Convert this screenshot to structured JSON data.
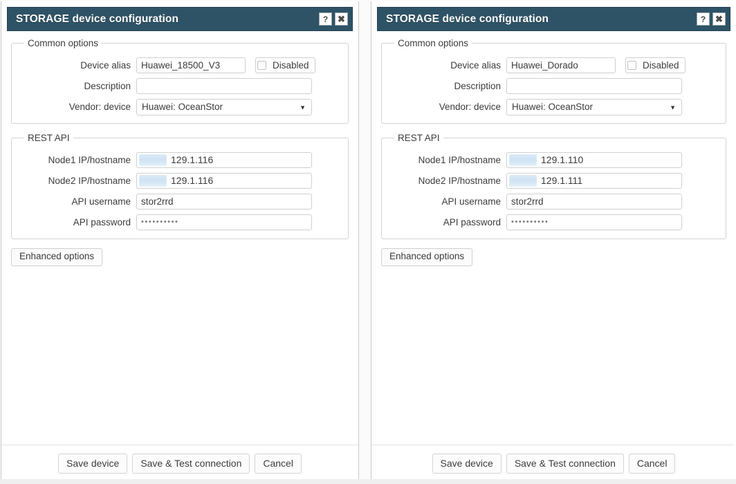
{
  "theme": {
    "titlebar_bg": "#2e5366",
    "titlebar_text": "#ffffff",
    "dialog_bg": "#ffffff",
    "border": "#cfcfcf",
    "label_text": "#3b3b3b",
    "redaction": "#cfe3f4"
  },
  "icons": {
    "help": "?",
    "close": "✖",
    "dropdown_caret": "▼",
    "checkbox_unchecked": "checkbox-unchecked-icon"
  },
  "panels": [
    {
      "id": "left",
      "titlebar": {
        "title": "STORAGE device configuration",
        "help_label": "?",
        "close_label": "✖"
      },
      "common_options": {
        "legend": "Common options",
        "device_alias": {
          "label": "Device alias",
          "value": "Huawei_18500_V3",
          "placeholder": ""
        },
        "disabled": {
          "label": "Disabled",
          "checked": false
        },
        "description": {
          "label": "Description",
          "value": "",
          "placeholder": ""
        },
        "vendor_device": {
          "label": "Vendor: device",
          "value": "Huawei: OceanStor",
          "options": [
            "Huawei: OceanStor"
          ]
        }
      },
      "rest_api": {
        "legend": "REST API",
        "node1": {
          "label": "Node1 IP/hostname",
          "redacted_prefix": true,
          "value": "129.1.116"
        },
        "node2": {
          "label": "Node2 IP/hostname",
          "redacted_prefix": true,
          "value": "129.1.116"
        },
        "username": {
          "label": "API username",
          "value": "stor2rrd",
          "placeholder": ""
        },
        "password": {
          "label": "API password",
          "value": "••••••••••",
          "placeholder": ""
        }
      },
      "enhanced_options_label": "Enhanced options",
      "footer": {
        "save_device": "Save device",
        "save_and_test": "Save & Test connection",
        "cancel": "Cancel"
      }
    },
    {
      "id": "right",
      "titlebar": {
        "title": "STORAGE device configuration",
        "help_label": "?",
        "close_label": "✖"
      },
      "common_options": {
        "legend": "Common options",
        "device_alias": {
          "label": "Device alias",
          "value": "Huawei_Dorado",
          "placeholder": ""
        },
        "disabled": {
          "label": "Disabled",
          "checked": false
        },
        "description": {
          "label": "Description",
          "value": "",
          "placeholder": ""
        },
        "vendor_device": {
          "label": "Vendor: device",
          "value": "Huawei: OceanStor",
          "options": [
            "Huawei: OceanStor"
          ]
        }
      },
      "rest_api": {
        "legend": "REST API",
        "node1": {
          "label": "Node1 IP/hostname",
          "redacted_prefix": true,
          "value": "129.1.110"
        },
        "node2": {
          "label": "Node2 IP/hostname",
          "redacted_prefix": true,
          "value": "129.1.111"
        },
        "username": {
          "label": "API username",
          "value": "stor2rrd",
          "placeholder": ""
        },
        "password": {
          "label": "API password",
          "value": "••••••••••",
          "placeholder": ""
        }
      },
      "enhanced_options_label": "Enhanced options",
      "footer": {
        "save_device": "Save device",
        "save_and_test": "Save & Test connection",
        "cancel": "Cancel"
      }
    }
  ]
}
